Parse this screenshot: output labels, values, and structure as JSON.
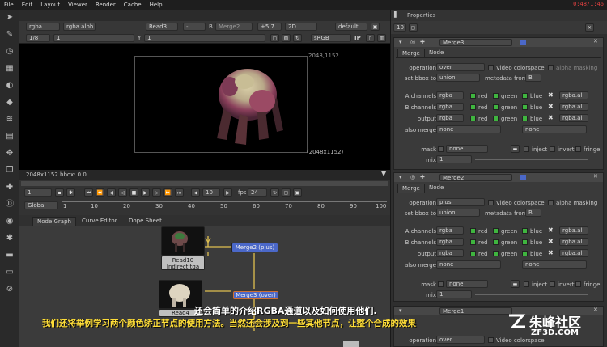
{
  "menu": {
    "items": [
      "File",
      "Edit",
      "Layout",
      "Viewer",
      "Render",
      "Cache",
      "Help"
    ],
    "clock": "0:48/1:46"
  },
  "viewer_bar1": {
    "channels": "rgba",
    "channel_sel": "rgba.alph",
    "a_input": "Read3",
    "b_label": "B",
    "b_input": "Merge2",
    "gain": "+5.7",
    "view": "2D",
    "lut": "default"
  },
  "viewer_bar2": {
    "proxy": "1/8",
    "frame": "1",
    "y_label": "Y",
    "y_value": "1",
    "colorspace": "sRGB",
    "ip": "IP"
  },
  "viewer": {
    "format_top": "2048,1152",
    "format_bottom": "(2048x1152)",
    "bbox": "2048x1152  bbox: 0 0"
  },
  "timeline": {
    "frame": "1",
    "step": "10",
    "fps_label": "fps",
    "fps": "24",
    "scope": "Global",
    "ticks": [
      "1",
      "10",
      "20",
      "30",
      "40",
      "50",
      "60",
      "70",
      "80",
      "90",
      "100"
    ]
  },
  "graph_tabs": [
    "Node Graph",
    "Curve Editor",
    "Dope Sheet"
  ],
  "nodes": {
    "read10": "Read10",
    "read10_file": "Indirect.tga",
    "read4": "Read4",
    "merge2": "Merge2 (plus)",
    "merge3": "Merge3 (over)"
  },
  "properties": {
    "title": "Properties",
    "count": "10"
  },
  "merge3": {
    "name": "Merge3",
    "tab1": "Merge",
    "tab2": "Node",
    "operation_lbl": "operation",
    "operation": "over",
    "video_cs": "Video colorspace",
    "alpha_mask": "alpha masking",
    "bbox_lbl": "set bbox to",
    "bbox": "union",
    "meta_lbl": "metadata from",
    "meta": "B",
    "a_lbl": "A channels",
    "a_ch": "rgba",
    "b_lbl": "B channels",
    "b_ch": "rgba",
    "out_lbl": "output",
    "out_ch": "rgba",
    "also_lbl": "also merge",
    "also": "none",
    "also2": "none",
    "ch_red": "red",
    "ch_green": "green",
    "ch_blue": "blue",
    "alpha_sel": "rgba.al",
    "mask_lbl": "mask",
    "mask": "none",
    "inject": "inject",
    "invert": "invert",
    "fringe": "fringe",
    "mix_lbl": "mix",
    "mix": "1"
  },
  "merge2": {
    "name": "Merge2",
    "tab1": "Merge",
    "tab2": "Node",
    "operation_lbl": "operation",
    "operation": "plus",
    "video_cs": "Video colorspace",
    "alpha_mask": "alpha masking",
    "bbox_lbl": "set bbox to",
    "bbox": "union",
    "meta_lbl": "metadata from",
    "meta": "B",
    "a_lbl": "A channels",
    "a_ch": "rgba",
    "b_lbl": "B channels",
    "b_ch": "rgba",
    "out_lbl": "output",
    "out_ch": "rgba",
    "also_lbl": "also merge",
    "also": "none",
    "also2": "none",
    "ch_red": "red",
    "ch_green": "green",
    "ch_blue": "blue",
    "alpha_sel": "rgba.al",
    "mask_lbl": "mask",
    "mask": "none",
    "inject": "inject",
    "invert": "invert",
    "fringe": "fringe",
    "mix_lbl": "mix",
    "mix": "1"
  },
  "merge1": {
    "name": "Merge1",
    "operation_lbl": "operation",
    "operation": "over",
    "video_cs": "Video colorspace"
  },
  "subtitles": {
    "line1": "还会简单的介绍RGBA通道以及如何使用他们.",
    "line2": "我们还将举例学习两个颜色矫正节点的使用方法。当然还会涉及到一些其他节点，让整个合成的效果"
  },
  "watermark": {
    "brand": "朱峰社区",
    "url": "ZF3D.COM"
  }
}
